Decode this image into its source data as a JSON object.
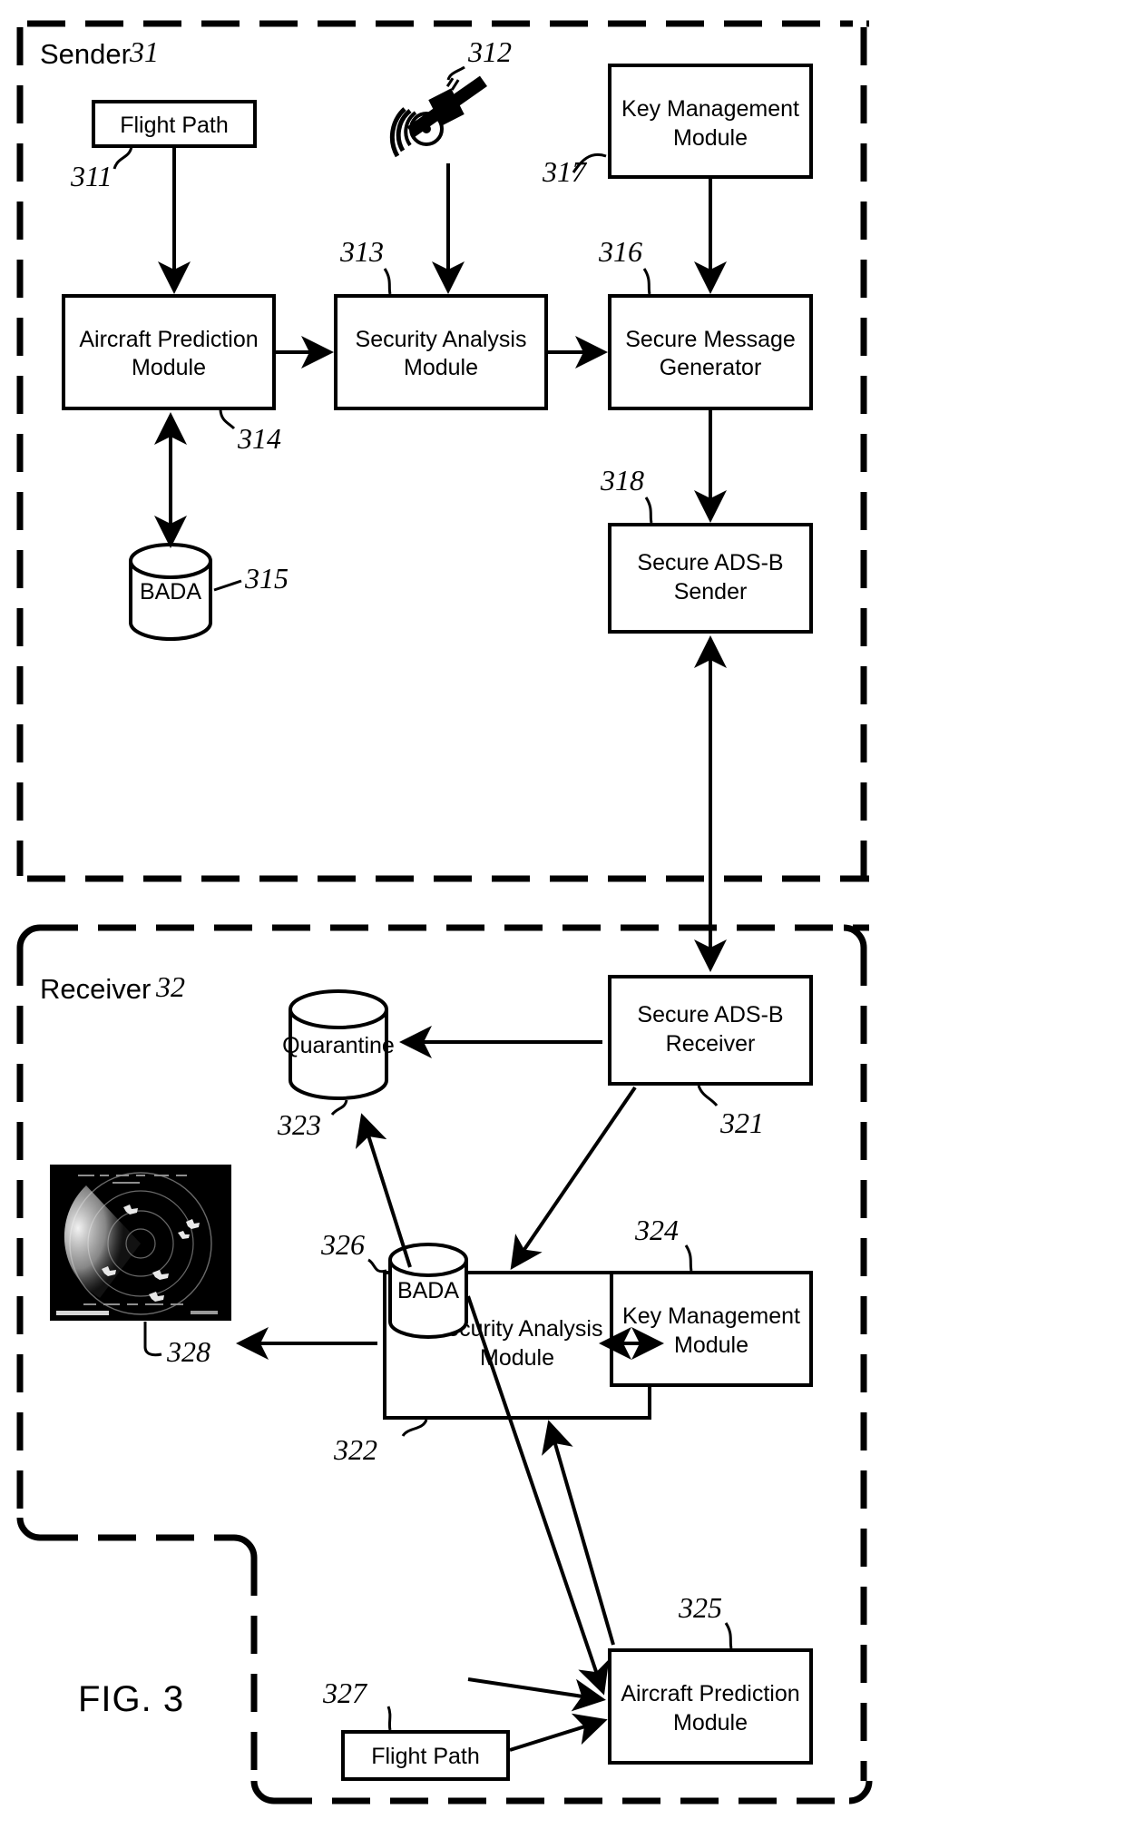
{
  "figure": {
    "caption": "FIG. 3"
  },
  "sections": [
    {
      "id": "sender",
      "label": "Sender",
      "ref": "31"
    },
    {
      "id": "receiver",
      "label": "Receiver",
      "ref": "32"
    }
  ],
  "sender": {
    "nodes": [
      {
        "id": "flight-path",
        "shape": "box",
        "label": "Flight Path",
        "ref": "311"
      },
      {
        "id": "satellite",
        "shape": "icon",
        "label": "satellite-icon",
        "ref": "312"
      },
      {
        "id": "key-management",
        "shape": "box",
        "label1": "Key Management",
        "label2": "Module",
        "ref": "317"
      },
      {
        "id": "aircraft-prediction",
        "shape": "box",
        "label1": "Aircraft Prediction",
        "label2": "Module",
        "ref": "314"
      },
      {
        "id": "security-analysis",
        "shape": "box",
        "label1": "Security Analysis",
        "label2": "Module",
        "ref": "313"
      },
      {
        "id": "secure-message-gen",
        "shape": "box",
        "label1": "Secure Message",
        "label2": "Generator",
        "ref": "316"
      },
      {
        "id": "bada",
        "shape": "cylinder",
        "label": "BADA",
        "ref": "315"
      },
      {
        "id": "secure-adsb-sender",
        "shape": "box",
        "label1": "Secure ADS-B",
        "label2": "Sender",
        "ref": "318"
      }
    ]
  },
  "receiver": {
    "nodes": [
      {
        "id": "quarantine",
        "shape": "cylinder",
        "label": "Quarantine",
        "ref": "323"
      },
      {
        "id": "secure-adsb-receiver",
        "shape": "box",
        "label1": "Secure ADS-B",
        "label2": "Receiver",
        "ref": "321"
      },
      {
        "id": "radar-display",
        "shape": "image",
        "label": "radar-display-image",
        "ref": "328"
      },
      {
        "id": "security-analysis",
        "shape": "box",
        "label1": "Security Analysis",
        "label2": "Module",
        "ref": "322"
      },
      {
        "id": "key-management",
        "shape": "box",
        "label1": "Key Management",
        "label2": "Module",
        "ref": "324"
      },
      {
        "id": "bada",
        "shape": "cylinder",
        "label": "BADA",
        "ref": "326"
      },
      {
        "id": "flight-path",
        "shape": "box",
        "label": "Flight Path",
        "ref": "327"
      },
      {
        "id": "aircraft-prediction",
        "shape": "box",
        "label1": "Aircraft Prediction",
        "label2": "Module",
        "ref": "325"
      }
    ]
  },
  "colors": {
    "line": "#000000",
    "background": "#ffffff",
    "radar_background": "#000000"
  }
}
